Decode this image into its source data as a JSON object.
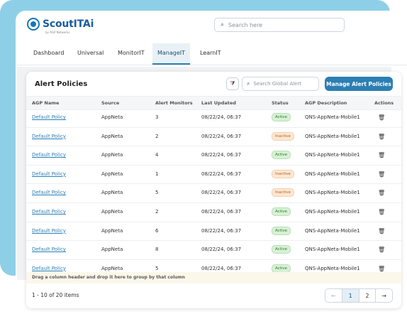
{
  "app": {
    "logo_text": "ScoutITAi",
    "logo_sub": "by AGP Networks"
  },
  "search": {
    "placeholder": "Search here"
  },
  "tabs": [
    {
      "label": "Dashboard"
    },
    {
      "label": "Universal"
    },
    {
      "label": "MonitorIT"
    },
    {
      "label": "ManageIT",
      "active": true
    },
    {
      "label": "LearnIT"
    }
  ],
  "panel": {
    "title": "Alert Policies",
    "global_search_placeholder": "Search Global Alert",
    "manage_button": "Manage Alert Policies"
  },
  "table": {
    "columns": [
      "AGP Name",
      "Source",
      "Alert Monitors",
      "Last Updated",
      "Status",
      "AGP Description",
      "Actions"
    ],
    "rows": [
      {
        "name": "Default Policy",
        "source": "AppNeta",
        "monitors": "3",
        "updated": "08/22/24, 06:37",
        "status": "Active",
        "desc": "QNS-AppNeta-Mobile1"
      },
      {
        "name": "Default Policy",
        "source": "AppNeta",
        "monitors": "2",
        "updated": "08/22/24, 06:37",
        "status": "Inactive",
        "desc": "QNS-AppNeta-Mobile1"
      },
      {
        "name": "Default Policy",
        "source": "AppNeta",
        "monitors": "4",
        "updated": "08/22/24, 06:37",
        "status": "Active",
        "desc": "QNS-AppNeta-Mobile1"
      },
      {
        "name": "Default Policy",
        "source": "AppNeta",
        "monitors": "1",
        "updated": "08/22/24, 06:37",
        "status": "Inactive",
        "desc": "QNS-AppNeta-Mobile1"
      },
      {
        "name": "Default Policy",
        "source": "AppNeta",
        "monitors": "5",
        "updated": "08/22/24, 06:37",
        "status": "Inactive",
        "desc": "QNS-AppNeta-Mobile1"
      },
      {
        "name": "Default Policy",
        "source": "AppNeta",
        "monitors": "2",
        "updated": "08/22/24, 06:37",
        "status": "Active",
        "desc": "QNS-AppNeta-Mobile1"
      },
      {
        "name": "Default Policy",
        "source": "AppNeta",
        "monitors": "6",
        "updated": "08/22/24, 06:37",
        "status": "Active",
        "desc": "QNS-AppNeta-Mobile1"
      },
      {
        "name": "Default Policy",
        "source": "AppNeta",
        "monitors": "8",
        "updated": "08/22/24, 06:37",
        "status": "Active",
        "desc": "QNS-AppNeta-Mobile1"
      },
      {
        "name": "Default Policy",
        "source": "AppNeta",
        "monitors": "5",
        "updated": "08/22/24, 06:37",
        "status": "Active",
        "desc": "QNS-AppNeta-Mobile1"
      }
    ],
    "group_hint": "Drag a column header and drop it here to group by that column"
  },
  "footer": {
    "count": "1 - 10 of 20 items",
    "pages": [
      "1",
      "2"
    ]
  },
  "icons": {
    "search": "search-icon",
    "filter": "filter-icon",
    "delete": "trash-icon",
    "prev": "arrow-left-icon",
    "next": "arrow-right-icon"
  },
  "colors": {
    "accent": "#2b7fb4",
    "active_badge": "#d8f0d6",
    "inactive_badge": "#fde7d3",
    "backdrop": "#8ecfe8"
  }
}
